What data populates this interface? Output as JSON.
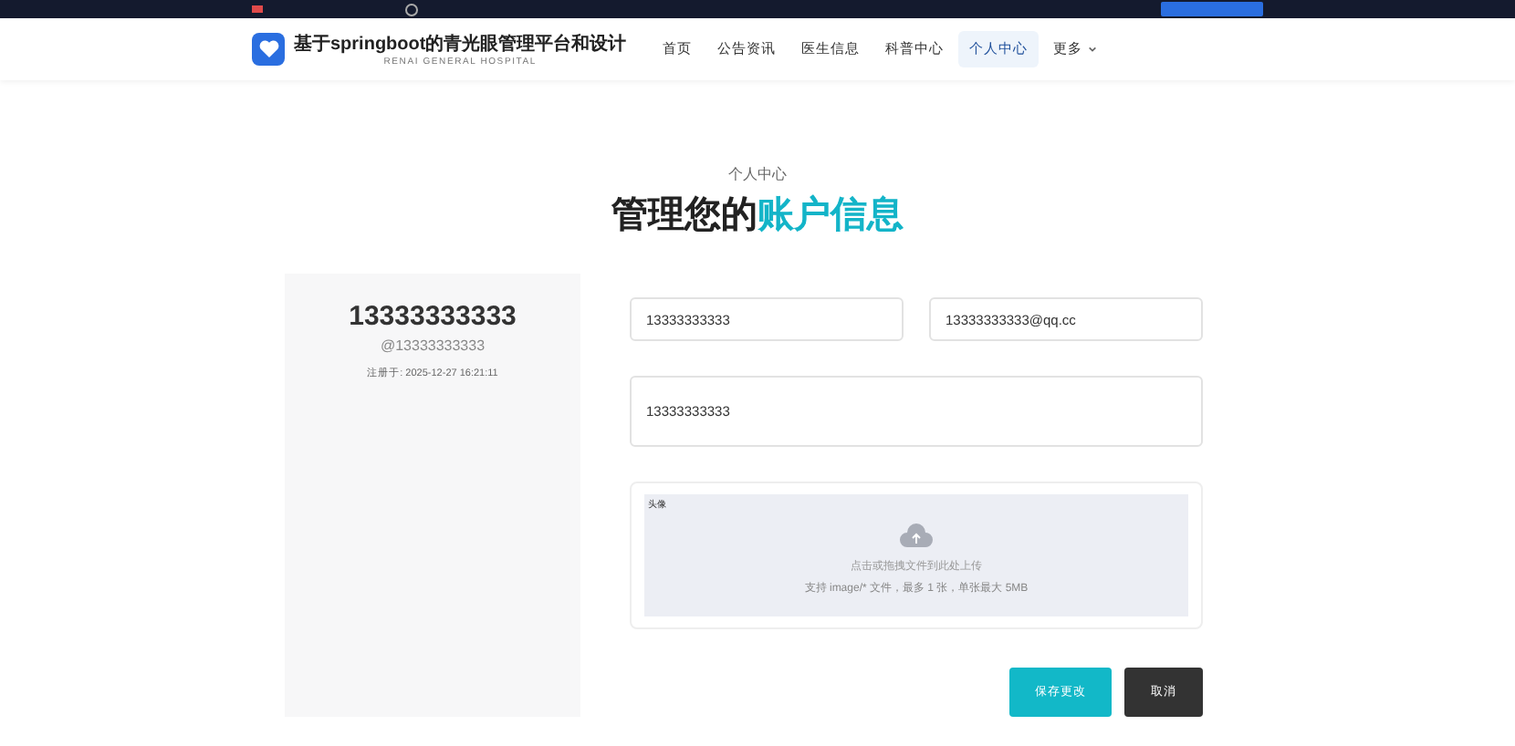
{
  "header": {
    "title": "基于springboot的青光眼管理平台和设计",
    "subtitle": "RENAI GENERAL HOSPITAL"
  },
  "nav": [
    {
      "label": "首页",
      "selected": false
    },
    {
      "label": "公告资讯",
      "selected": false
    },
    {
      "label": "医生信息",
      "selected": false
    },
    {
      "label": "科普中心",
      "selected": false
    },
    {
      "label": "个人中心",
      "selected": true
    },
    {
      "label": "更多",
      "selected": false
    }
  ],
  "hero": {
    "eyebrow": "个人中心",
    "title": "管理您的",
    "title_highlight": "账户信息"
  },
  "profile": {
    "name": "13333333333",
    "handle": "@13333333333",
    "registered": "注册于: 2025-12-27 16:21:11"
  },
  "fields": [
    {
      "value": "13333333333"
    },
    {
      "value": "13333333333@qq.cc"
    },
    {
      "value": "13333333333"
    }
  ],
  "upload": {
    "label": "头像",
    "hint": "点击或拖拽文件到此处上传",
    "note": "支持 image/* 文件，最多 1 张，单张最大 5MB"
  },
  "buttons": [
    {
      "label": "保存更改",
      "kind": "primary"
    },
    {
      "label": "取消",
      "kind": "dark"
    }
  ]
}
